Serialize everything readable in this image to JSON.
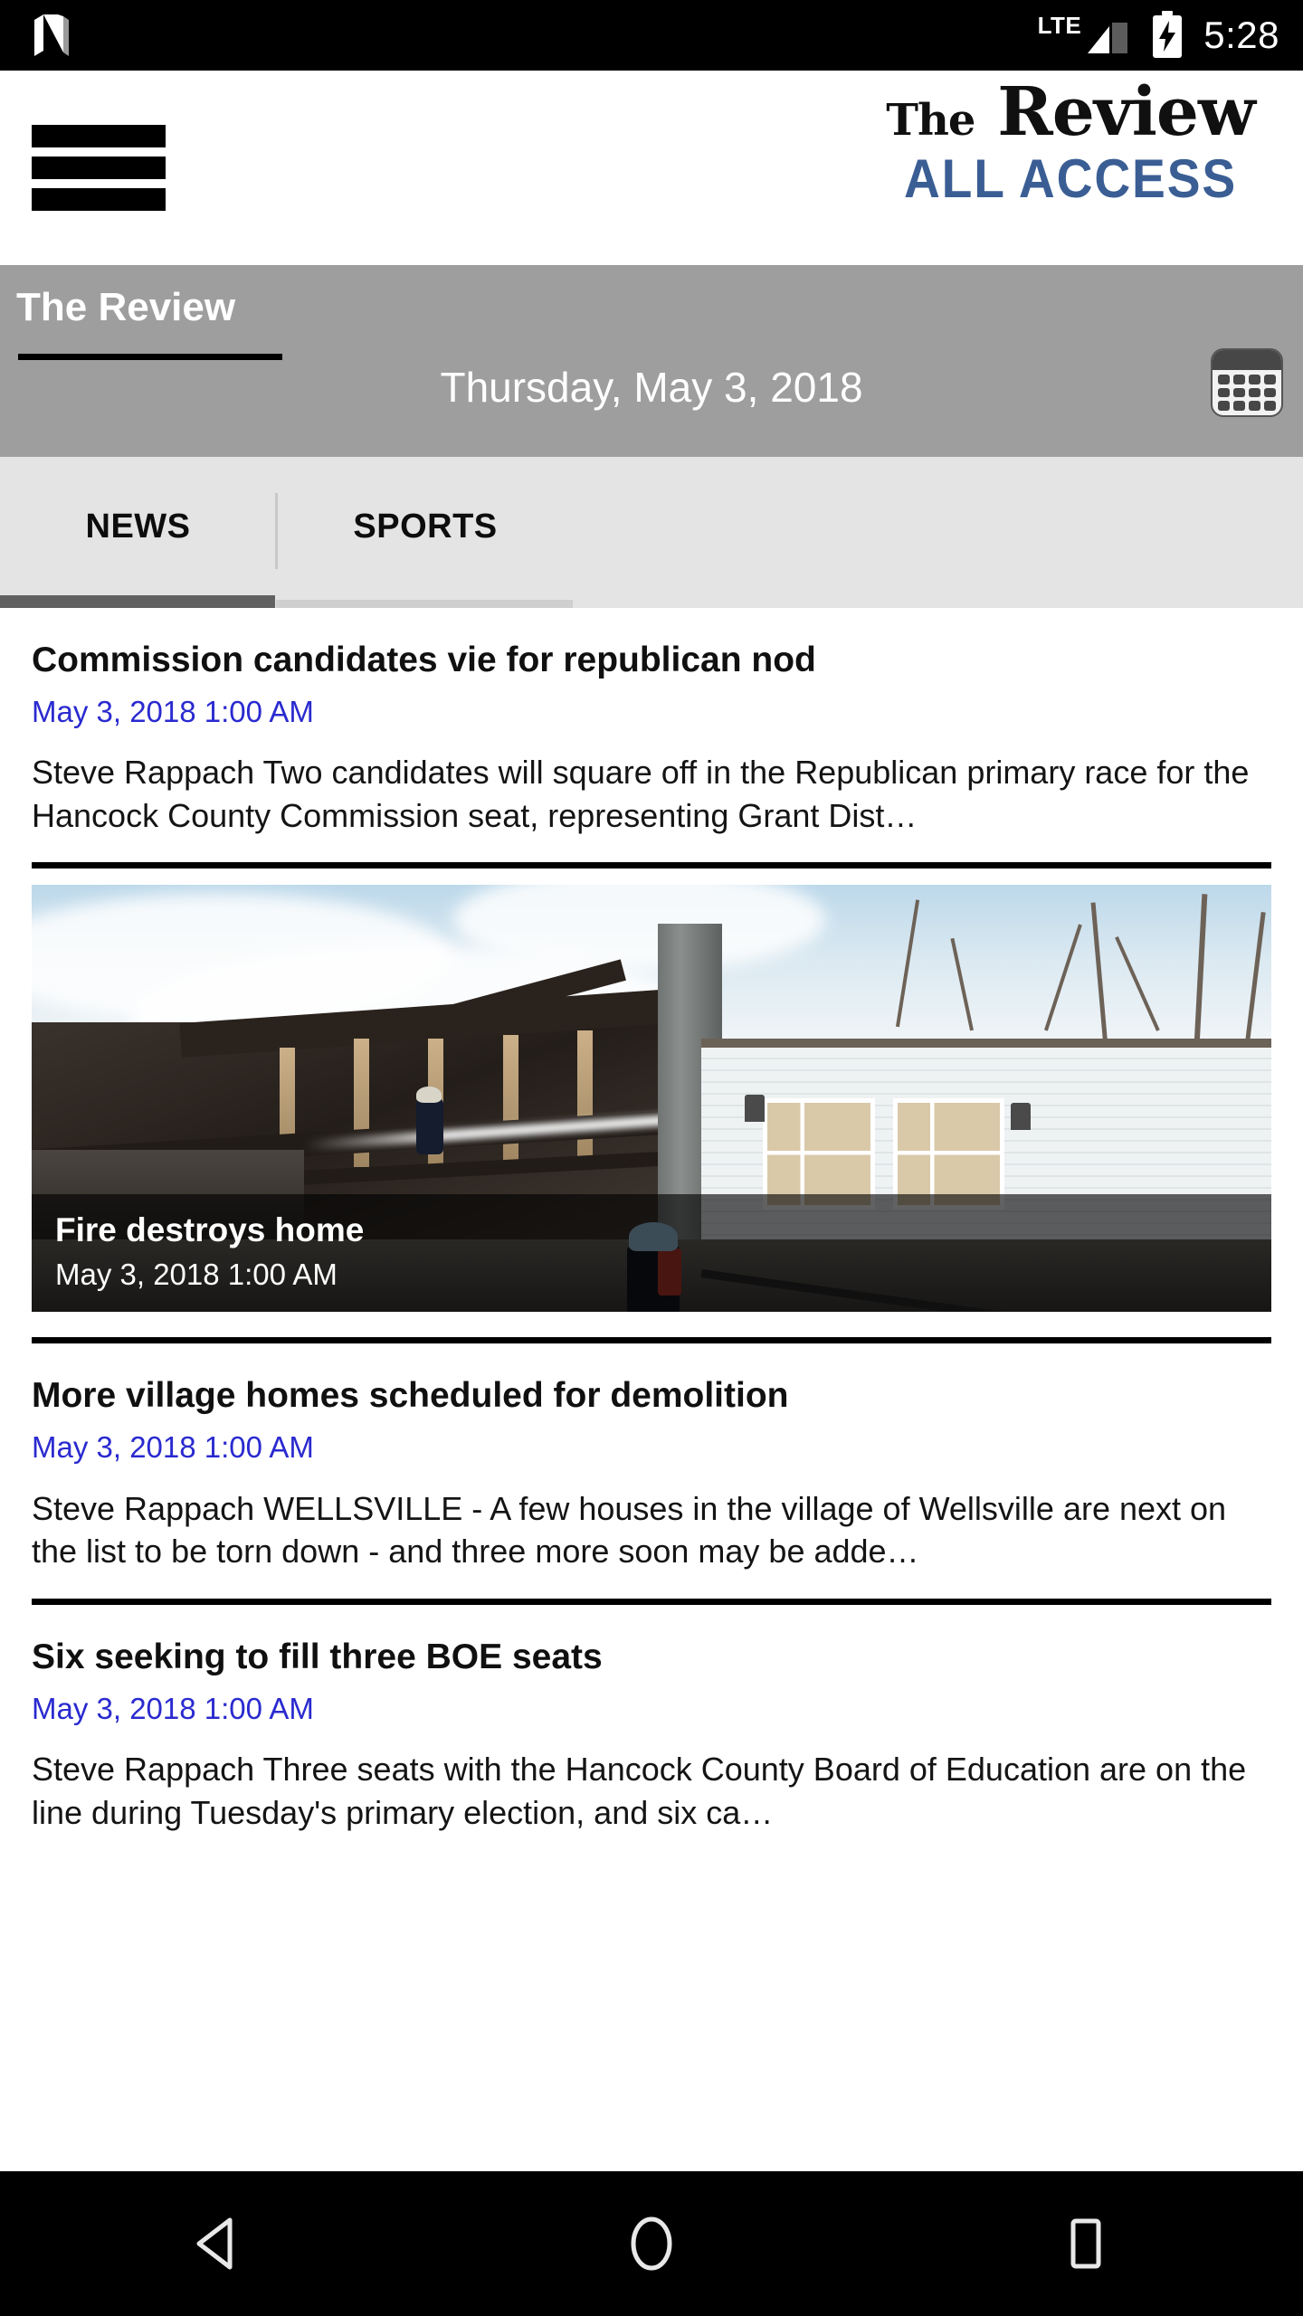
{
  "statusbar": {
    "app_icon": "nextdoor-n-icon",
    "network_label": "LTE",
    "signal_icon": "signal-bars-icon",
    "battery_icon": "battery-charging-icon",
    "clock": "5:28"
  },
  "masthead": {
    "menu_icon": "hamburger-menu-icon",
    "logo_the": "The",
    "logo_review": "Review",
    "logo_sub": "ALL ACCESS"
  },
  "sectionbar": {
    "section_label": "The Review",
    "date_label": "Thursday, May 3, 2018",
    "calendar_icon": "calendar-icon",
    "bg_color": "#9e9e9e"
  },
  "tabs": {
    "items": [
      {
        "label": "NEWS",
        "active": true
      },
      {
        "label": "SPORTS",
        "active": false
      }
    ],
    "active_indicator_color": "#616161",
    "inactive_indicator_color": "#cfcfcf",
    "bg_color": "#e4e4e4"
  },
  "feed": {
    "date_color": "#2a2ad0",
    "stories": [
      {
        "title": "Commission candidates vie for republican nod",
        "date": "May 3, 2018 1:00 AM",
        "excerpt": "Steve Rappach Two candidates will square off in the Republican primary race for the Hancock County Commission seat, representing Grant Dist…"
      },
      {
        "title": "More village homes scheduled for demolition",
        "date": "May 3, 2018 1:00 AM",
        "excerpt": "Steve Rappach WELLSVILLE - A few houses in the village of Wellsville are next on the list to be torn down - and three more soon may be adde…"
      },
      {
        "title": "Six seeking to fill three BOE seats",
        "date": "May 3, 2018 1:00 AM",
        "excerpt": "Steve Rappach Three seats with the Hancock County Board of Education are on the line during Tuesday's primary election, and six ca…"
      }
    ],
    "photo_story": {
      "title": "Fire destroys home",
      "date": "May 3, 2018 1:00 AM",
      "image_alt": "burned-house-firefighter-photo"
    }
  },
  "navbar": {
    "back_icon": "back-triangle-icon",
    "home_icon": "home-circle-icon",
    "recents_icon": "recents-square-icon"
  }
}
